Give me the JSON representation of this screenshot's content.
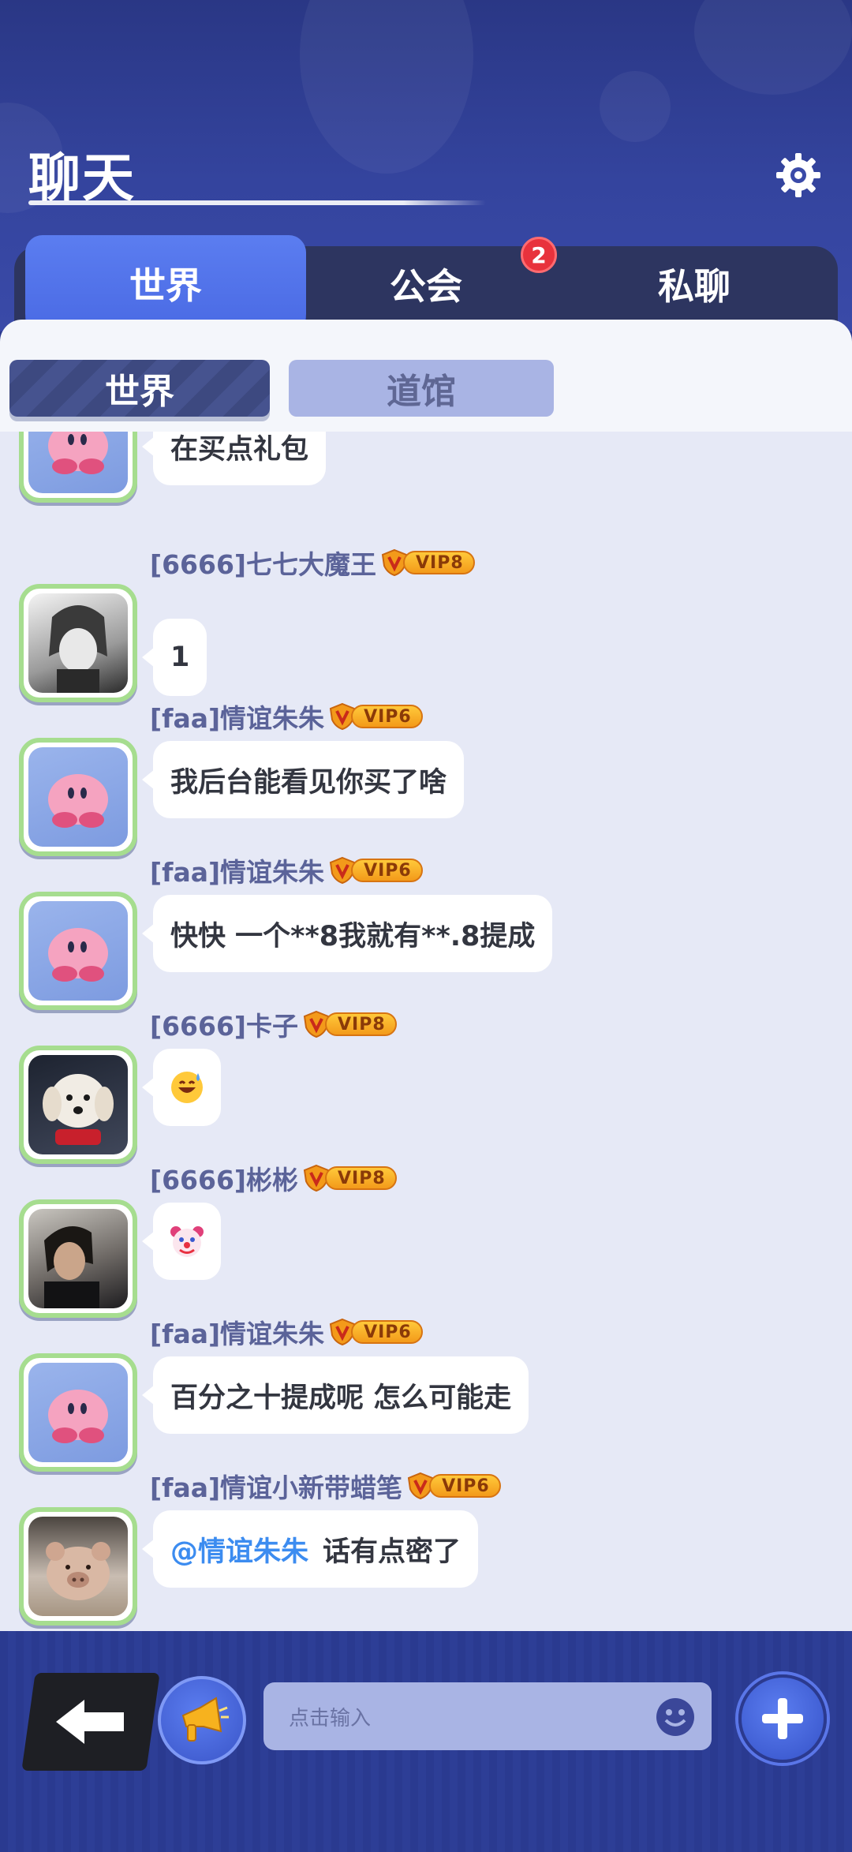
{
  "header": {
    "title": "聊天"
  },
  "tabs": [
    {
      "label": "世界"
    },
    {
      "label": "公会",
      "badge": "2"
    },
    {
      "label": "私聊"
    }
  ],
  "subtabs": [
    {
      "label": "世界"
    },
    {
      "label": "道馆"
    }
  ],
  "messages": [
    {
      "sender": "",
      "vip": "",
      "text": "在买点礼包",
      "avatar": "kirby-avatar"
    },
    {
      "sender": "[6666]七七大魔王",
      "vip": "VIP8",
      "text": "1",
      "avatar": "anime-avatar"
    },
    {
      "sender": "[faa]情谊朱朱",
      "vip": "VIP6",
      "text": "我后台能看见你买了啥",
      "avatar": "kirby-avatar"
    },
    {
      "sender": "[faa]情谊朱朱",
      "vip": "VIP6",
      "text": "快快 一个**8我就有**.8提成",
      "avatar": "kirby-avatar"
    },
    {
      "sender": "[6666]卡子",
      "vip": "VIP8",
      "text": "",
      "emoji": "grinning-sweat-emoji",
      "avatar": "dog-avatar"
    },
    {
      "sender": "[6666]彬彬",
      "vip": "VIP8",
      "text": "",
      "emoji": "clown-face-emoji",
      "avatar": "boy-avatar"
    },
    {
      "sender": "[faa]情谊朱朱",
      "vip": "VIP6",
      "text": "百分之十提成呢 怎么可能走",
      "avatar": "kirby-avatar"
    },
    {
      "sender": "[faa]情谊小新带蜡笔",
      "vip": "VIP6",
      "mention": "@情谊朱朱",
      "text": "话有点密了",
      "avatar": "pig-avatar"
    }
  ],
  "input": {
    "placeholder": "点击输入"
  },
  "colors": {
    "header_bg": "#2a3785",
    "tab_active": "#4a6ae4",
    "chat_bg": "#e6e9f6",
    "username": "#5b6399",
    "mention": "#3c8cf0",
    "badge": "#e8323c",
    "vip_gold": "#f39a1a"
  }
}
